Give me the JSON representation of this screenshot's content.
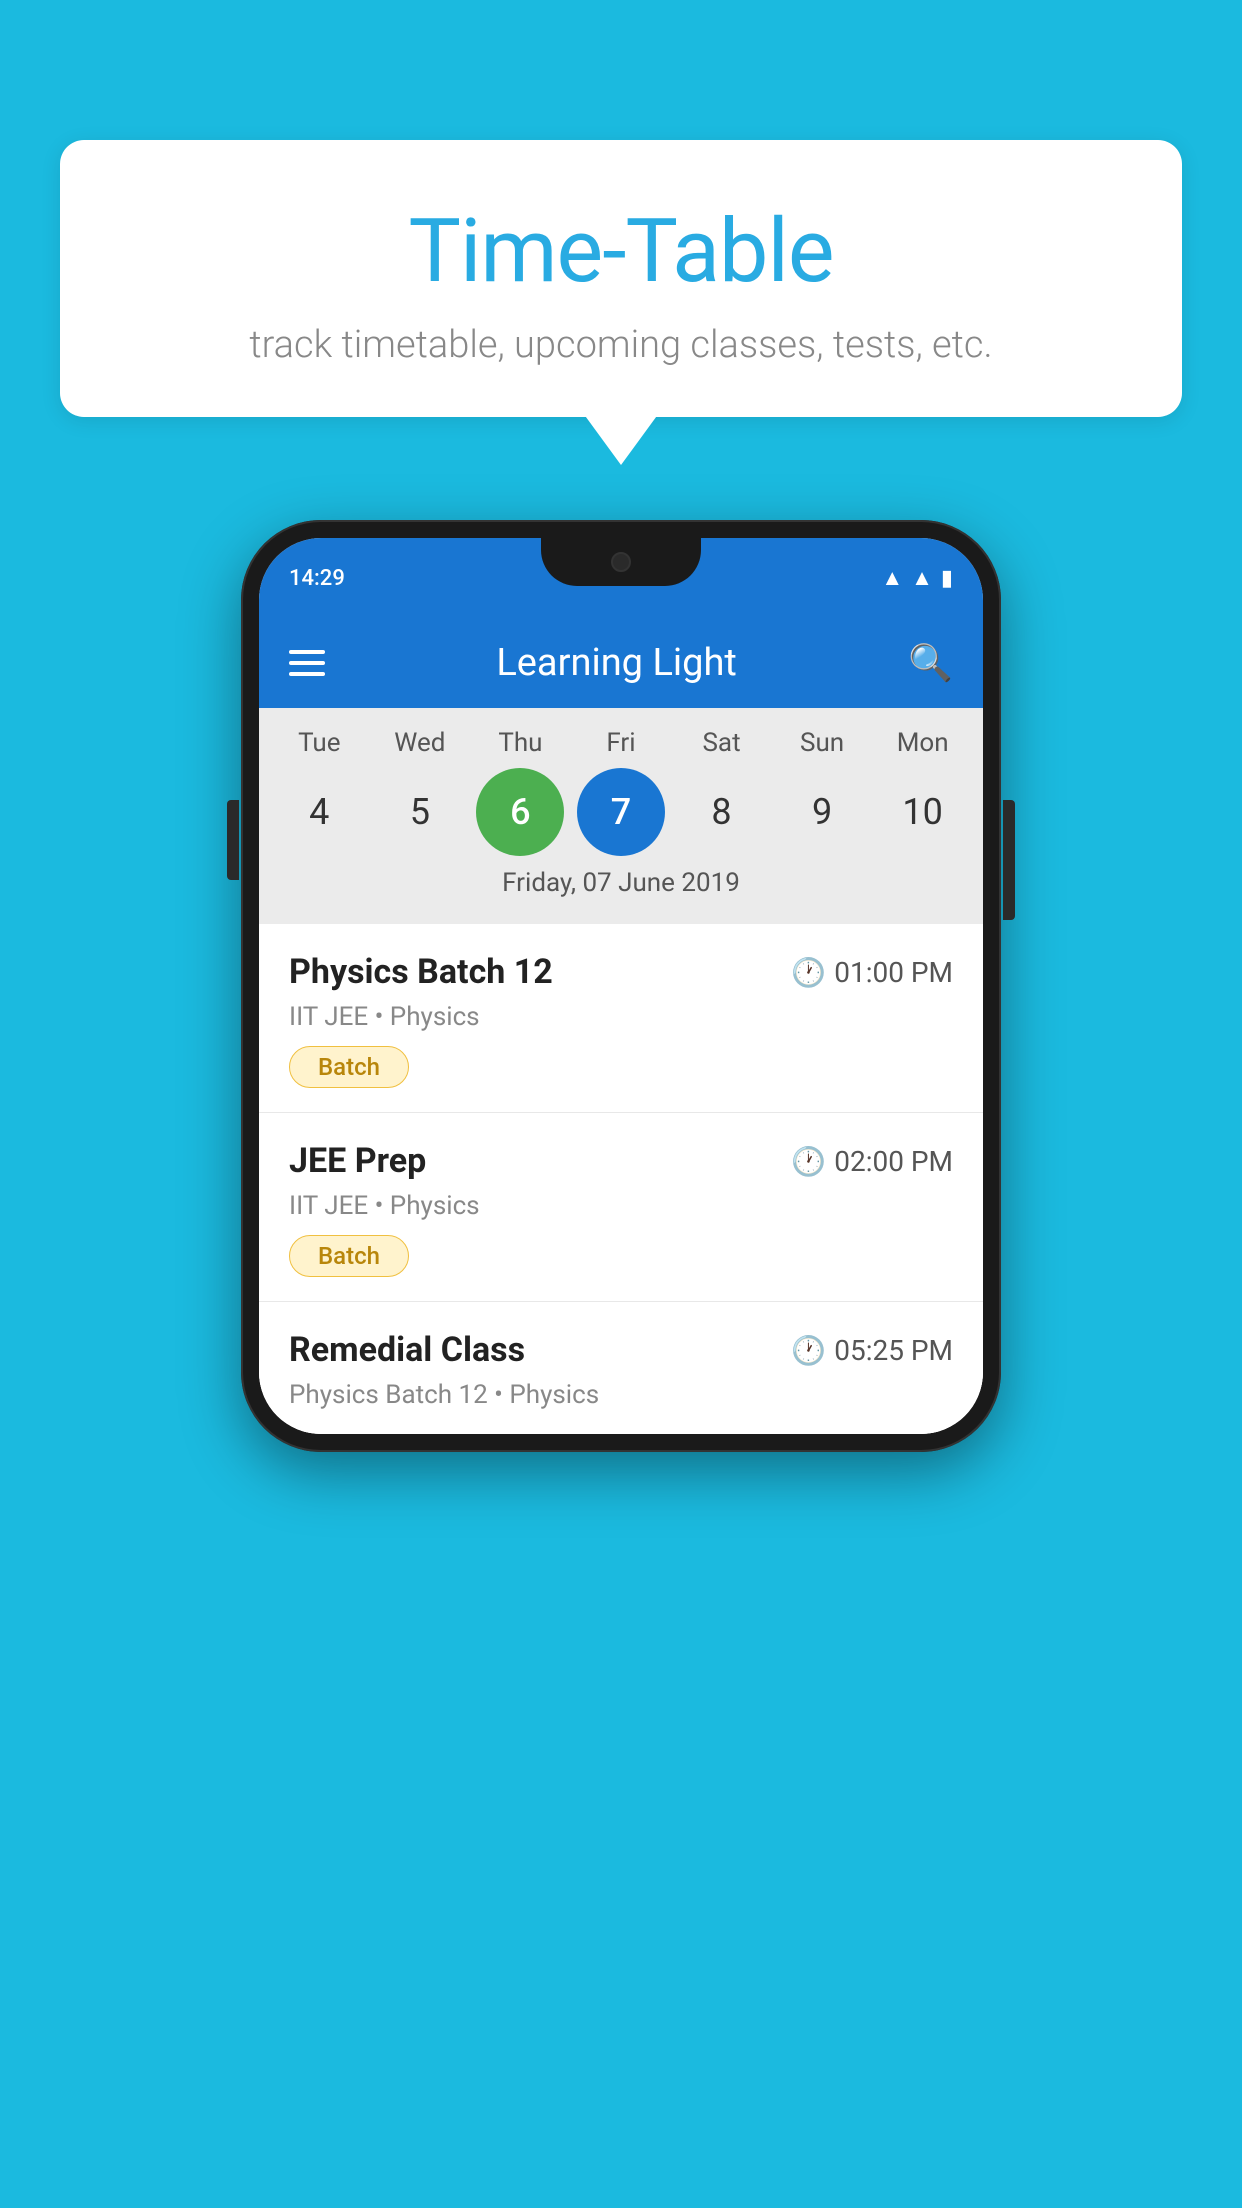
{
  "background_color": "#1BBADF",
  "speech_bubble": {
    "title": "Time-Table",
    "subtitle": "track timetable, upcoming classes, tests, etc."
  },
  "phone": {
    "status_bar": {
      "time": "14:29",
      "wifi": "▲",
      "signal": "▲",
      "battery": "▮"
    },
    "app_bar": {
      "title": "Learning Light",
      "menu_icon": "menu",
      "search_icon": "search"
    },
    "calendar": {
      "days": [
        {
          "label": "Tue",
          "number": "4"
        },
        {
          "label": "Wed",
          "number": "5"
        },
        {
          "label": "Thu",
          "number": "6",
          "state": "today"
        },
        {
          "label": "Fri",
          "number": "7",
          "state": "selected"
        },
        {
          "label": "Sat",
          "number": "8"
        },
        {
          "label": "Sun",
          "number": "9"
        },
        {
          "label": "Mon",
          "number": "10"
        }
      ],
      "selected_date_label": "Friday, 07 June 2019"
    },
    "schedule": [
      {
        "title": "Physics Batch 12",
        "time": "01:00 PM",
        "meta": "IIT JEE • Physics",
        "badge": "Batch"
      },
      {
        "title": "JEE Prep",
        "time": "02:00 PM",
        "meta": "IIT JEE • Physics",
        "badge": "Batch"
      },
      {
        "title": "Remedial Class",
        "time": "05:25 PM",
        "meta": "Physics Batch 12 • Physics",
        "badge": null
      }
    ]
  }
}
